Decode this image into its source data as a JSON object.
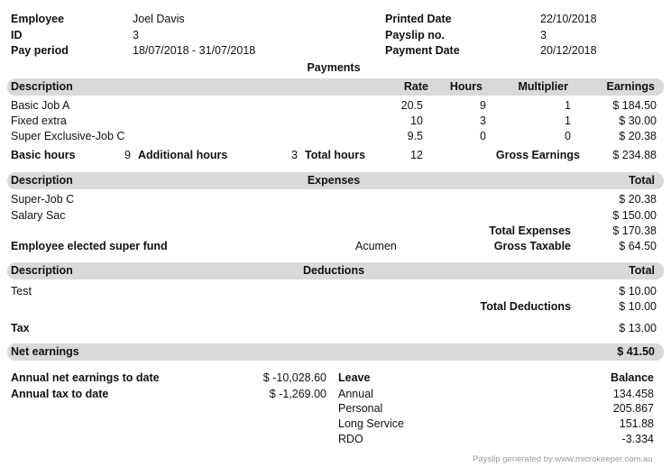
{
  "header": {
    "employee_label": "Employee",
    "employee_value": "Joel Davis",
    "id_label": "ID",
    "id_value": "3",
    "pay_period_label": "Pay period",
    "pay_period_value": "18/07/2018 - 31/07/2018",
    "printed_date_label": "Printed Date",
    "printed_date_value": "22/10/2018",
    "payslip_no_label": "Payslip no.",
    "payslip_no_value": "3",
    "payment_date_label": "Payment Date",
    "payment_date_value": "20/12/2018"
  },
  "payments": {
    "section_title": "Payments",
    "columns": {
      "description": "Description",
      "rate": "Rate",
      "hours": "Hours",
      "multiplier": "Multiplier",
      "earnings": "Earnings"
    },
    "rows": [
      {
        "description": "Basic Job A",
        "rate": "20.5",
        "hours": "9",
        "multiplier": "1",
        "earnings": "$ 184.50"
      },
      {
        "description": "Fixed extra",
        "rate": "10",
        "hours": "3",
        "multiplier": "1",
        "earnings": "$ 30.00"
      },
      {
        "description": "Super Exclusive-Job C",
        "rate": "9.5",
        "hours": "0",
        "multiplier": "0",
        "earnings": "$ 20.38"
      }
    ],
    "summary": {
      "basic_hours_label": "Basic hours",
      "basic_hours_value": "9",
      "additional_hours_label": "Additional hours",
      "additional_hours_value": "3",
      "total_hours_label": "Total hours",
      "total_hours_value": "12",
      "gross_earnings_label": "Gross Earnings",
      "gross_earnings_value": "$ 234.88"
    }
  },
  "expenses": {
    "columns": {
      "description": "Description",
      "title": "Expenses",
      "total": "Total"
    },
    "rows": [
      {
        "description": "Super-Job C",
        "total": "$ 20.38"
      },
      {
        "description": "Salary Sac",
        "total": "$ 150.00"
      }
    ],
    "total_expenses_label": "Total Expenses",
    "total_expenses_value": "$ 170.38",
    "super_fund_label": "Employee elected super fund",
    "super_fund_value": "Acumen",
    "gross_taxable_label": "Gross Taxable",
    "gross_taxable_value": "$ 64.50"
  },
  "deductions": {
    "columns": {
      "description": "Description",
      "title": "Deductions",
      "total": "Total"
    },
    "rows": [
      {
        "description": "Test",
        "total": "$ 10.00"
      }
    ],
    "total_deductions_label": "Total Deductions",
    "total_deductions_value": "$ 10.00"
  },
  "tax": {
    "label": "Tax",
    "value": "$ 13.00"
  },
  "net_earnings": {
    "label": "Net earnings",
    "value": "$ 41.50"
  },
  "ytd": {
    "annual_net_label": "Annual net earnings to date",
    "annual_net_value": "$ -10,028.60",
    "annual_tax_label": "Annual tax to date",
    "annual_tax_value": "$ -1,269.00"
  },
  "leave": {
    "leave_label": "Leave",
    "balance_label": "Balance",
    "rows": [
      {
        "name": "Annual",
        "balance": "134.458"
      },
      {
        "name": "Personal",
        "balance": "205.867"
      },
      {
        "name": "Long Service",
        "balance": "151.88"
      },
      {
        "name": "RDO",
        "balance": "-3.334"
      }
    ]
  },
  "footer": {
    "text": "Payslip generated by www.microkeeper.com.au"
  }
}
